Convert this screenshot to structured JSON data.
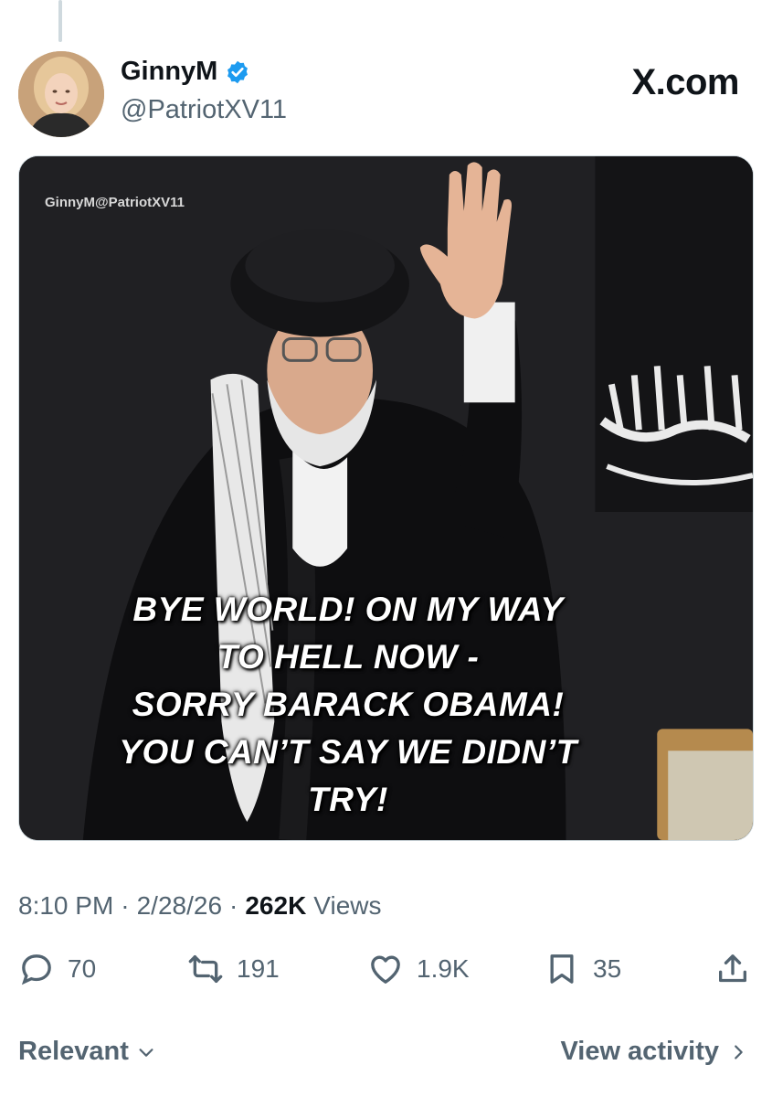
{
  "author": {
    "name": "GinnyM",
    "handle": "@PatriotXV11",
    "verified": true
  },
  "site_label": "X.com",
  "media": {
    "watermark": "GinnyM@PatriotXV11",
    "caption_lines": [
      "BYE WORLD! ON MY WAY",
      "TO HELL NOW -",
      "SORRY BARACK OBAMA!",
      "YOU CAN’T SAY WE DIDN’T",
      "TRY!"
    ]
  },
  "meta": {
    "time": "8:10 PM",
    "separator": "·",
    "date": "2/28/26",
    "views_count": "262K",
    "views_label": "Views"
  },
  "actions": {
    "replies": "70",
    "reposts": "191",
    "likes": "1.9K",
    "bookmarks": "35"
  },
  "footer": {
    "sort_label": "Relevant",
    "activity_label": "View activity"
  },
  "colors": {
    "verified": "#1d9bf0",
    "muted_text": "#536471",
    "primary_text": "#0f1419"
  },
  "icons": [
    "verified-badge-icon",
    "reply-icon",
    "repost-icon",
    "like-icon",
    "bookmark-icon",
    "share-icon",
    "chevron-down-icon",
    "chevron-right-icon"
  ]
}
